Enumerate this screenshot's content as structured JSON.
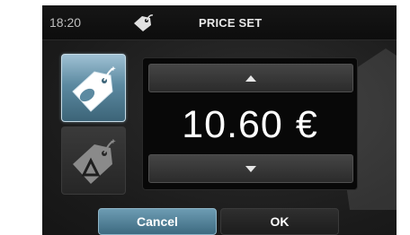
{
  "header": {
    "time": "18:20",
    "title": "PRICE SET",
    "icon": "price-tag-icon"
  },
  "modes": [
    {
      "name": "price",
      "icon": "price-tag-icon",
      "selected": true
    },
    {
      "name": "discount",
      "icon": "delta-tag-icon",
      "selected": false
    }
  ],
  "price": {
    "value": "10.60",
    "currency": "€"
  },
  "buttons": {
    "cancel": "Cancel",
    "ok": "OK"
  },
  "colors": {
    "accent": "#5c8aa1",
    "background": "#1b1b1b"
  }
}
